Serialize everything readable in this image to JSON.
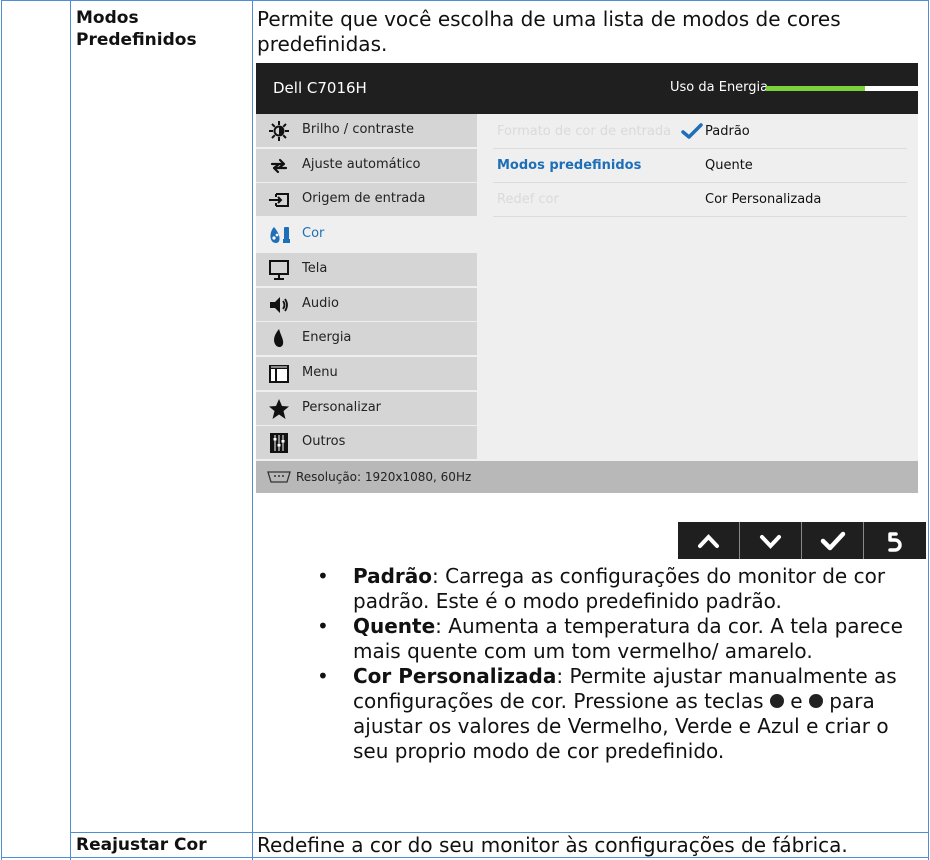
{
  "rows": [
    {
      "label": "Modos Predefinidos",
      "label_line1": "Modos",
      "label_line2": "Predefinidos",
      "intro": "Permite que você escolha de uma lista de modos de cores predefinidas.",
      "intro_line1": "Permite que você escolha de uma lista de modos de cores",
      "intro_line2": "predefinidas."
    },
    {
      "label": "Reajustar Cor",
      "text": "Redefine a cor do seu monitor às configurações de fábrica."
    }
  ],
  "osd": {
    "title": "Dell C7016H",
    "energy_label": "Uso da Energia",
    "energy_level": 0.65,
    "menu": [
      {
        "label": "Brilho / contraste",
        "icon": "brightness-icon"
      },
      {
        "label": "Ajuste automático",
        "icon": "auto-adjust-icon"
      },
      {
        "label": "Origem de entrada",
        "icon": "input-source-icon"
      },
      {
        "label": "Cor",
        "icon": "color-icon",
        "selected": true
      },
      {
        "label": "Tela",
        "icon": "display-icon"
      },
      {
        "label": "Audio",
        "icon": "speaker-icon"
      },
      {
        "label": "Energia",
        "icon": "energy-icon"
      },
      {
        "label": "Menu",
        "icon": "menu-icon"
      },
      {
        "label": "Personalizar",
        "icon": "star-icon"
      },
      {
        "label": "Outros",
        "icon": "sliders-icon"
      }
    ],
    "submenu": [
      {
        "key": "Formato de cor de entrada",
        "value": "Padrão",
        "checked": true
      },
      {
        "key": "Modos predefinidos",
        "value": "Quente",
        "active": true
      },
      {
        "key": "Redef cor",
        "value": "Cor Personalizada"
      }
    ],
    "resolution": "Resolução: 1920x1080, 60Hz",
    "nav_buttons": [
      "up-arrow-icon",
      "down-arrow-icon",
      "checkmark-icon",
      "back-icon"
    ]
  },
  "bullets": [
    {
      "term": "Padrão",
      "text": ": Carrega as configurações do monitor de cor padrão. Este é o modo predefinido padrão."
    },
    {
      "term": "Quente",
      "text": ": Aumenta a temperatura da cor. A tela parece mais quente com um tom vermelho/ amarelo."
    },
    {
      "term": "Cor Personalizada",
      "text_a": ": Permite ajustar manualmente as configurações de cor. Pressione as teclas ",
      "text_b": " e ",
      "text_c": " para ajustar os valores de Vermelho, Verde e Azul e criar o seu proprio modo de cor predefinido."
    }
  ],
  "colors": {
    "grid": "#4d8fd0",
    "osd_dark": "#1f1f1f",
    "accent_blue": "#1d6fb8",
    "energy_green": "#7bd13b"
  }
}
